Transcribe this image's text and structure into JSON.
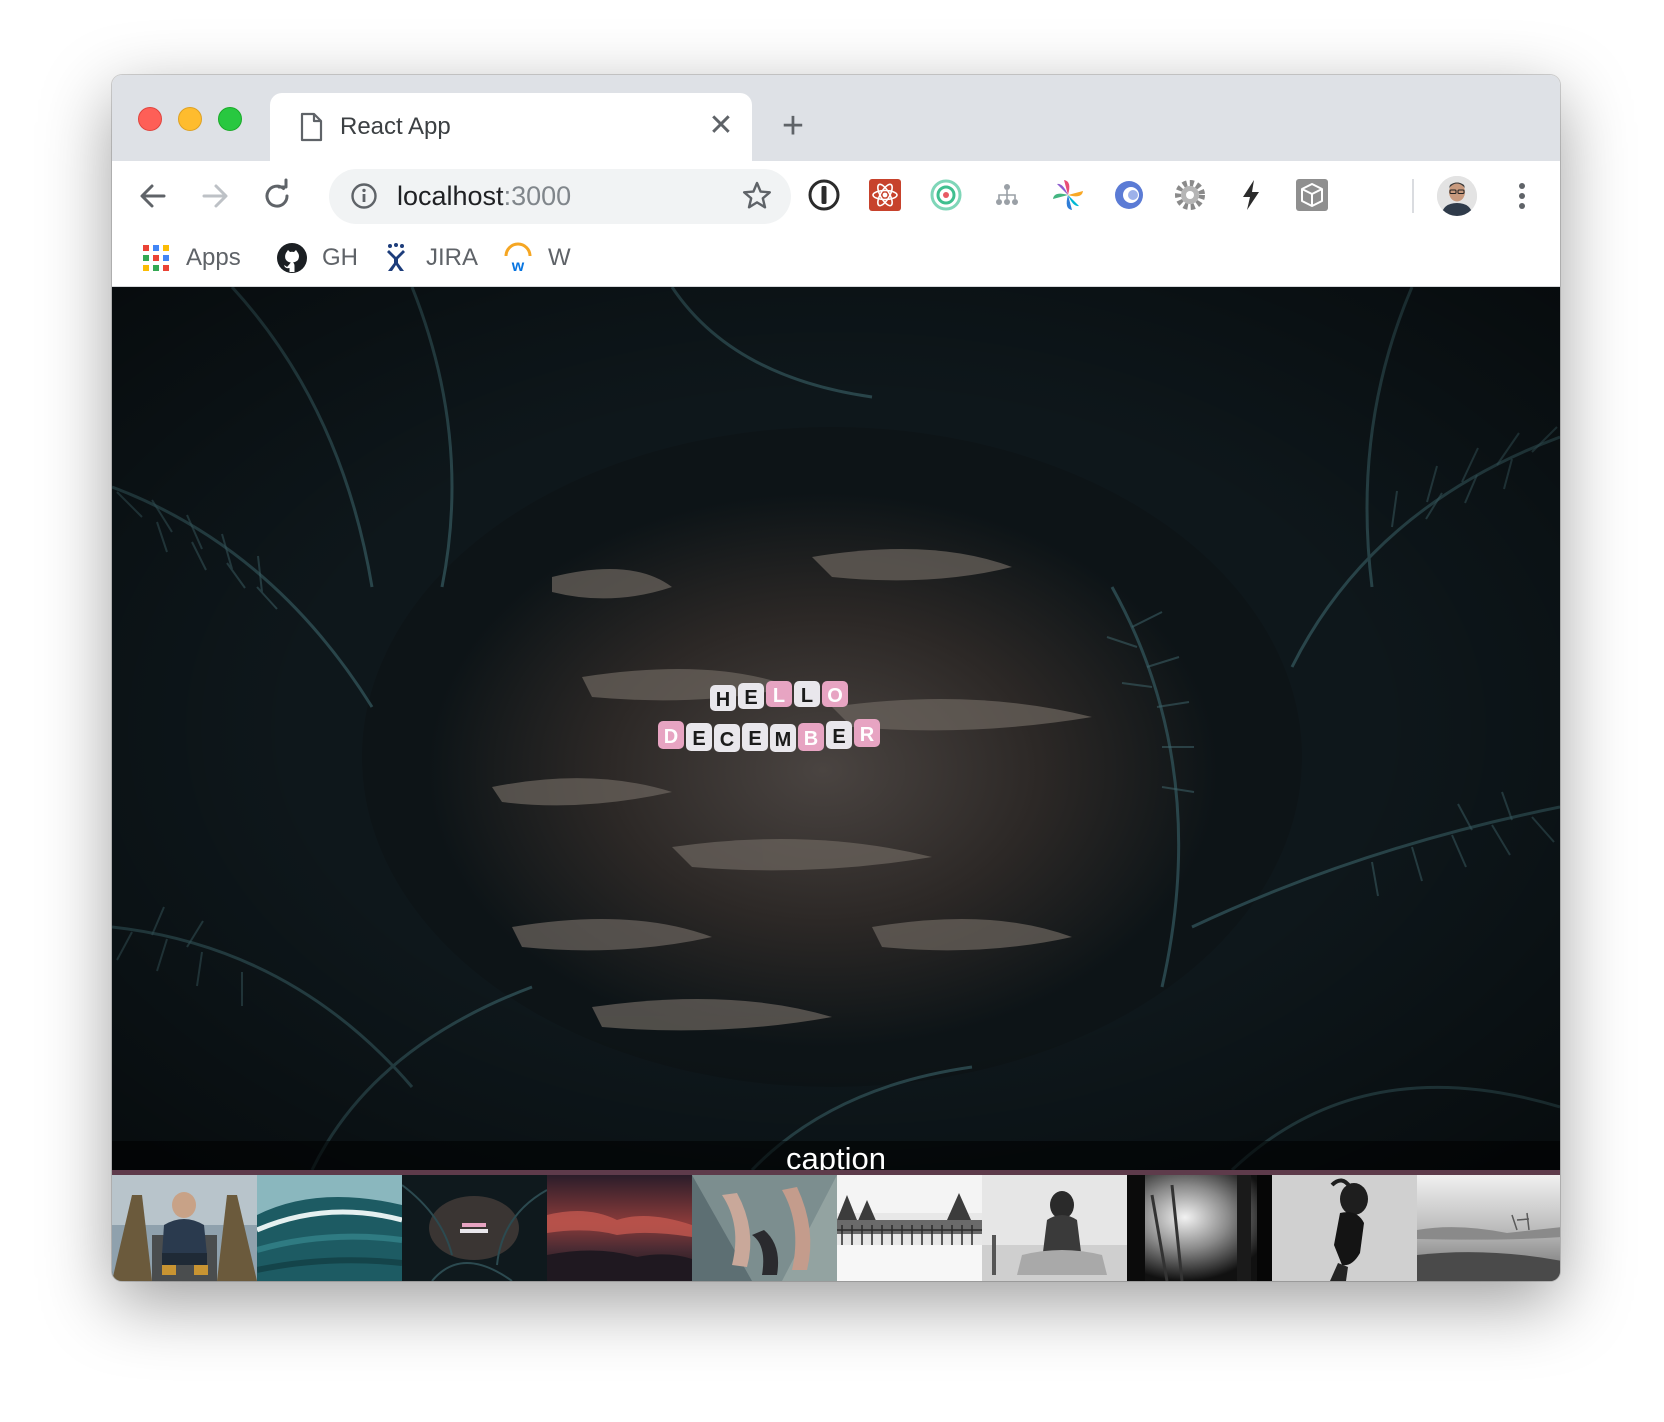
{
  "browser": {
    "tab": {
      "title": "React App",
      "close_glyph": "✕",
      "icon": "document-icon"
    },
    "new_tab_glyph": "+",
    "address": {
      "host": "localhost",
      "port": ":3000"
    },
    "extensions": [
      "1password-icon",
      "react-devtools-icon",
      "radar-icon",
      "sitemap-icon",
      "pinwheel-icon",
      "circle-logo-icon",
      "gear-icon",
      "bolt-icon",
      "cube-icon"
    ]
  },
  "bookmarks": [
    {
      "label": "Apps",
      "icon": "apps-grid-icon"
    },
    {
      "label": "GH",
      "icon": "github-icon"
    },
    {
      "label": "JIRA",
      "icon": "jira-icon"
    },
    {
      "label": "W",
      "icon": "workday-icon"
    }
  ],
  "gallery": {
    "caption": "caption",
    "hero_text": [
      "HELLO",
      "DECEMBER"
    ],
    "thumbnail_count": 10,
    "accent_color": "#5e3b4b"
  },
  "colors": {
    "tabstrip": "#dee1e6",
    "traffic_close": "#fe5f57",
    "traffic_minimize": "#febc2e",
    "traffic_maximize": "#28c840"
  }
}
